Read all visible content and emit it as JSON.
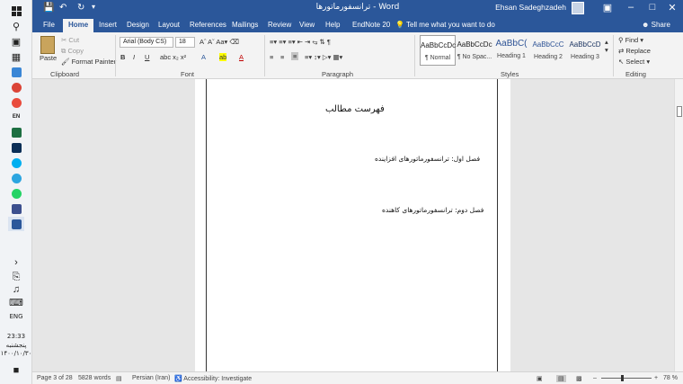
{
  "taskbar": {
    "lang_tray": "EN",
    "keyboard_lang": "ENG",
    "time": "23:33",
    "weekday": "پنجشنبه",
    "date": "۱۴۰۰/۱۰/۳۰"
  },
  "titlebar": {
    "title": "ترانسفورماتورها - Word",
    "user": "Ehsan Sadeghzadeh"
  },
  "tabs": [
    "File",
    "Home",
    "Insert",
    "Design",
    "Layout",
    "References",
    "Mailings",
    "Review",
    "View",
    "Help",
    "EndNote 20"
  ],
  "tell_me": "Tell me what you want to do",
  "share": "Share",
  "ribbon": {
    "clipboard": {
      "paste": "Paste",
      "cut": "Cut",
      "copy": "Copy",
      "format_painter": "Format Painter",
      "label": "Clipboard"
    },
    "font": {
      "family": "Arial (Body CS)",
      "size": "18",
      "label": "Font"
    },
    "paragraph": {
      "label": "Paragraph"
    },
    "styles": {
      "items": [
        {
          "preview": "AaBbCcDc",
          "name": "¶ Normal"
        },
        {
          "preview": "AaBbCcDc",
          "name": "¶ No Spac..."
        },
        {
          "preview": "AaBbC(",
          "name": "Heading 1"
        },
        {
          "preview": "AaBbCcC",
          "name": "Heading 2"
        },
        {
          "preview": "AaBbCcD",
          "name": "Heading 3"
        }
      ],
      "label": "Styles"
    },
    "editing": {
      "find": "Find",
      "replace": "Replace",
      "select": "Select",
      "label": "Editing"
    }
  },
  "document": {
    "heading": "فهرست مطالب",
    "line1": "فصل اول: ترانسفورماتورهای افزاینده",
    "line2": "فصل دوم: ترانسفورماتورهای کاهنده"
  },
  "status": {
    "page": "Page 3 of 28",
    "words": "5828 words",
    "language": "Persian (Iran)",
    "accessibility": "Accessibility: Investigate",
    "zoom": "78 %"
  },
  "colors": {
    "accent": "#2b579a"
  }
}
